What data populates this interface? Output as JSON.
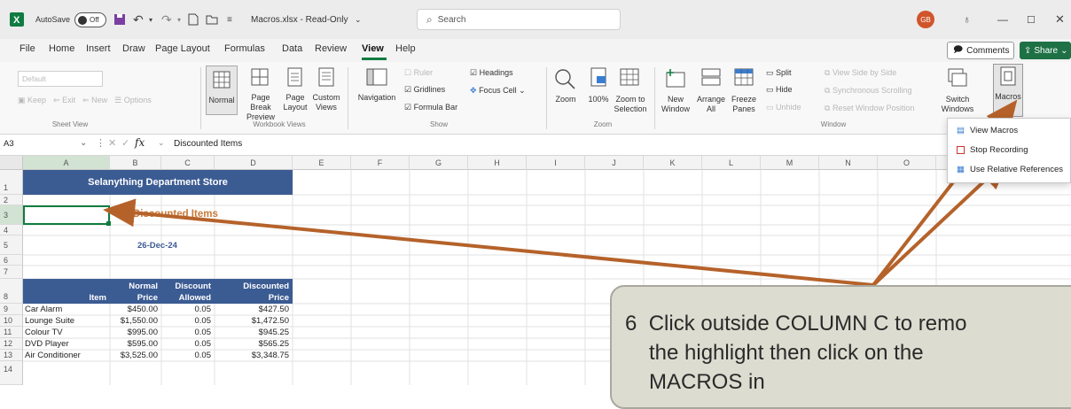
{
  "titlebar": {
    "autosave_label": "AutoSave",
    "autosave_state": "Off",
    "filename": "Macros.xlsx - Read-Only",
    "search_placeholder": "Search",
    "avatar": "GB"
  },
  "menu": [
    "File",
    "Home",
    "Insert",
    "Draw",
    "Page Layout",
    "Formulas",
    "Data",
    "Review",
    "View",
    "Help"
  ],
  "menu_active": "View",
  "comments_label": "Comments",
  "share_label": "Share",
  "ribbon": {
    "sheet_view": {
      "label": "Sheet View",
      "default": "Default",
      "keep": "Keep",
      "exit": "Exit",
      "new": "New",
      "options": "Options"
    },
    "workbook_views": {
      "label": "Workbook Views",
      "normal": "Normal",
      "page_break": "Page Break Preview",
      "page_layout": "Page Layout",
      "custom": "Custom Views"
    },
    "show": {
      "label": "Show",
      "navigation": "Navigation",
      "ruler": "Ruler",
      "gridlines": "Gridlines",
      "formula_bar": "Formula Bar",
      "headings": "Headings",
      "focus_cell": "Focus Cell"
    },
    "zoom": {
      "label": "Zoom",
      "zoom": "Zoom",
      "hundred": "100%",
      "zoom_to_sel": "Zoom to Selection"
    },
    "window": {
      "label": "Window",
      "new_window": "New Window",
      "arrange_all": "Arrange All",
      "freeze_panes": "Freeze Panes",
      "split": "Split",
      "hide": "Hide",
      "unhide": "Unhide",
      "view_side": "View Side by Side",
      "sync_scroll": "Synchronous Scrolling",
      "reset_pos": "Reset Window Position",
      "switch": "Switch Windows"
    },
    "macros": {
      "label": "Macros"
    }
  },
  "macros_menu": [
    "View Macros",
    "Stop Recording",
    "Use Relative References"
  ],
  "formula_bar": {
    "name_box": "A3",
    "fx": "fx",
    "content": "Discounted Items"
  },
  "columns": [
    "A",
    "B",
    "C",
    "D",
    "E",
    "F",
    "G",
    "H",
    "I",
    "J",
    "K",
    "L",
    "M",
    "N",
    "O"
  ],
  "rows": [
    "1",
    "2",
    "3",
    "4",
    "5",
    "6",
    "7",
    "8",
    "9",
    "10",
    "11",
    "12",
    "13",
    "14"
  ],
  "sheet": {
    "title": "Selanything Department Store",
    "subtitle": "Discounted Items",
    "date": "26-Dec-24",
    "headers": {
      "item": "Item",
      "normal": [
        "Normal",
        "Price"
      ],
      "discount": [
        "Discount",
        "Allowed"
      ],
      "discounted": [
        "Discounted",
        "Price"
      ]
    },
    "table": [
      [
        "Car Alarm",
        "$450.00",
        "0.05",
        "$427.50"
      ],
      [
        "Lounge Suite",
        "$1,550.00",
        "0.05",
        "$1,472.50"
      ],
      [
        "Colour TV",
        "$995.00",
        "0.05",
        "$945.25"
      ],
      [
        "DVD Player",
        "$595.00",
        "0.05",
        "$565.25"
      ],
      [
        "Air Conditioner",
        "$3,525.00",
        "0.05",
        "$3,348.75"
      ]
    ]
  },
  "callout": {
    "number": "6",
    "line1": "Click outside COLUMN C to remo",
    "line2": "the highlight then click on the",
    "line3": "MACROS in"
  },
  "colors": {
    "header_blue": "#3b5b93",
    "orange_title": "#c97a3b",
    "arrow": "#b5622a",
    "share_green": "#1e7145",
    "excel_green": "#107c41"
  }
}
